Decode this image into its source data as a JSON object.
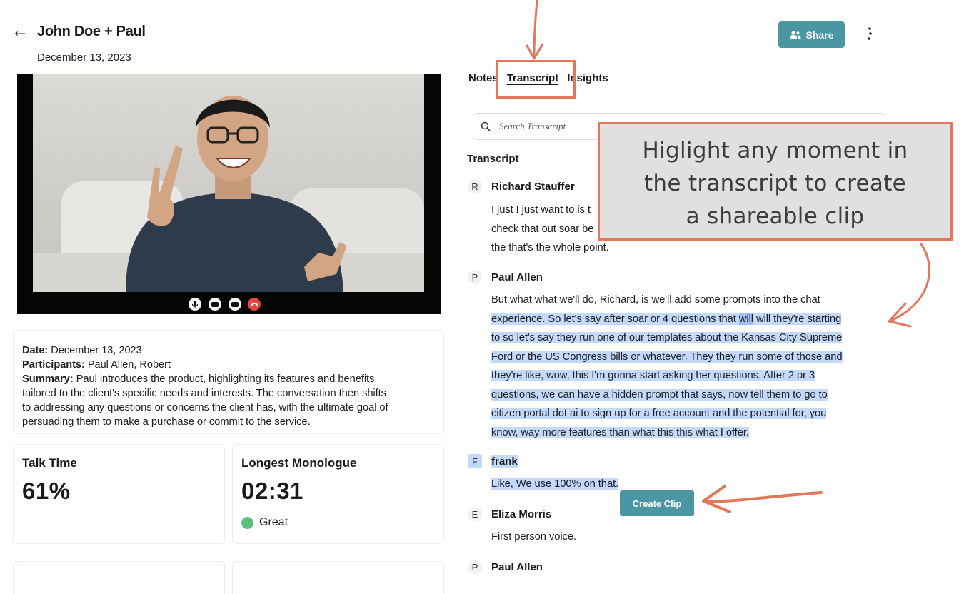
{
  "header": {
    "back_icon": "left-arrow-icon",
    "title": "John Doe + Paul",
    "date": "December 13, 2023",
    "share_label": "Share",
    "share_icon": "people-icon",
    "more_icon": "kebab-menu-icon"
  },
  "video": {
    "controls": [
      "microphone-icon",
      "camera-icon",
      "screen-share-icon",
      "hang-up-icon"
    ]
  },
  "summary": {
    "date_label": "Date:",
    "date_value": "December 13, 2023",
    "participants_label": "Participants:",
    "participants_value": "Paul Allen, Robert",
    "summary_label": "Summary:",
    "summary_lines": [
      "Paul introduces the product, highlighting its features and benefits",
      "tailored to the client's specific needs and interests. The conversation then shifts",
      "to addressing any questions or concerns the client has, with the ultimate goal of",
      "persuading them to make a purchase or commit to the service."
    ]
  },
  "stats": {
    "talk_time_label": "Talk Time",
    "talk_time_value": "61%",
    "monologue_label": "Longest Monologue",
    "monologue_value": "02:31",
    "monologue_rating": "Great",
    "rating_color": "#5cc07a"
  },
  "tabs": {
    "notes": "Notes",
    "transcript": "Transcript",
    "insights": "Insights"
  },
  "search": {
    "placeholder": "Search Transcript",
    "icon": "search-icon"
  },
  "transcript": {
    "heading": "Transcript",
    "entries": [
      {
        "initial": "R",
        "speaker": "Richard Stauffer",
        "lines": [
          "I just I just want to is t",
          "check that out soar be",
          "the that's the whole point."
        ]
      },
      {
        "initial": "P",
        "speaker": "Paul Allen",
        "line_first": "But what what we'll do, Richard, is we'll add some prompts into the chat",
        "line2_before": "experience. So let's say after soar or 4 questions that ",
        "line2_word": "will",
        "line2_after": " will they're starting",
        "lines_rest": [
          "to so let's say they run one of our templates about the Kansas City Supreme",
          "Ford or the US Congress bills or whatever. They they run some of those and",
          "they're like, wow, this I'm gonna start asking her questions. After 2 or 3",
          "questions, we can have a hidden prompt that says, now tell them to go to",
          "citizen portal dot ai to sign up for a free account and the potential for, you",
          "know, way more features than what this this what I offer."
        ]
      },
      {
        "initial": "F",
        "speaker": "frank",
        "lines": [
          "Like, We use 100% on that."
        ]
      },
      {
        "initial": "E",
        "speaker": "Eliza Morris",
        "lines": [
          "First person voice."
        ]
      },
      {
        "initial": "P",
        "speaker": "Paul Allen",
        "lines": []
      }
    ]
  },
  "callout": {
    "lines": [
      "Higlight any moment in",
      "the transcript to create",
      "a shareable clip"
    ],
    "border_color": "#e3775c"
  },
  "create_clip_label": "Create Clip",
  "colors": {
    "accent": "#4a97a3",
    "highlight": "#c4dafc",
    "annotation": "#e3775c"
  }
}
